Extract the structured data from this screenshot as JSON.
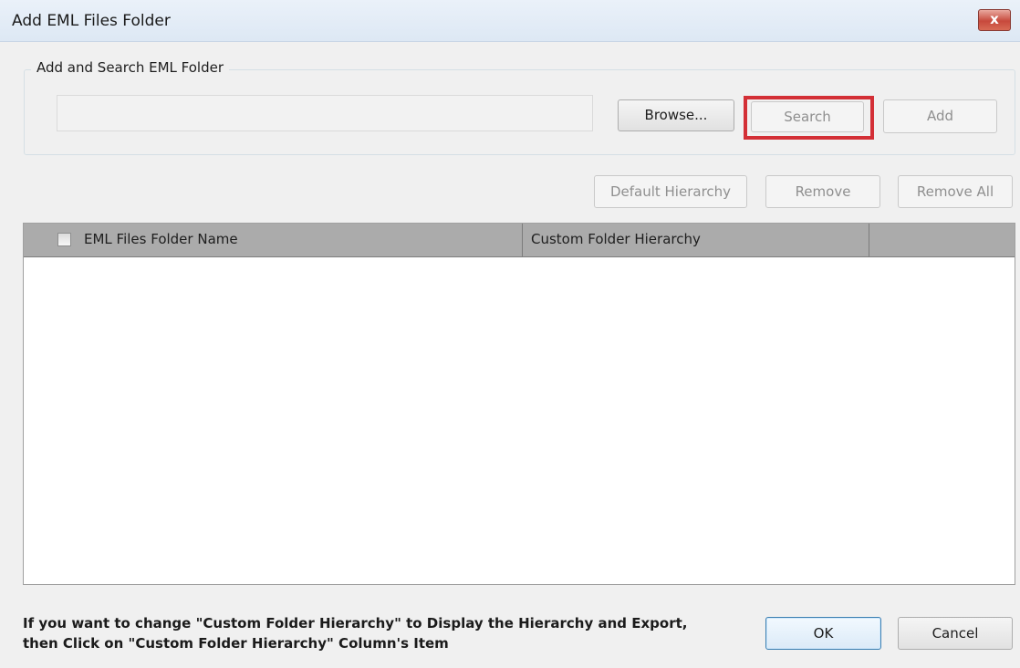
{
  "window": {
    "title": "Add EML Files Folder",
    "close_symbol": "x"
  },
  "search_group": {
    "legend": "Add and Search EML Folder",
    "path_value": "",
    "browse_label": "Browse...",
    "search_label": "Search",
    "add_label": "Add",
    "search_highlight_color": "#d32f36"
  },
  "actions": {
    "default_hierarchy_label": "Default Hierarchy",
    "remove_label": "Remove",
    "remove_all_label": "Remove All"
  },
  "table": {
    "columns": [
      "EML Files Folder Name",
      "Custom Folder Hierarchy",
      ""
    ],
    "select_all_checked": false,
    "rows": []
  },
  "footer": {
    "note_line1": "If you want to change \"Custom Folder Hierarchy\" to Display the Hierarchy and Export,",
    "note_line2": "then Click on \"Custom Folder Hierarchy\" Column's Item",
    "ok_label": "OK",
    "cancel_label": "Cancel"
  },
  "icons": {
    "close": "close-icon",
    "checkbox": "checkbox-icon"
  }
}
